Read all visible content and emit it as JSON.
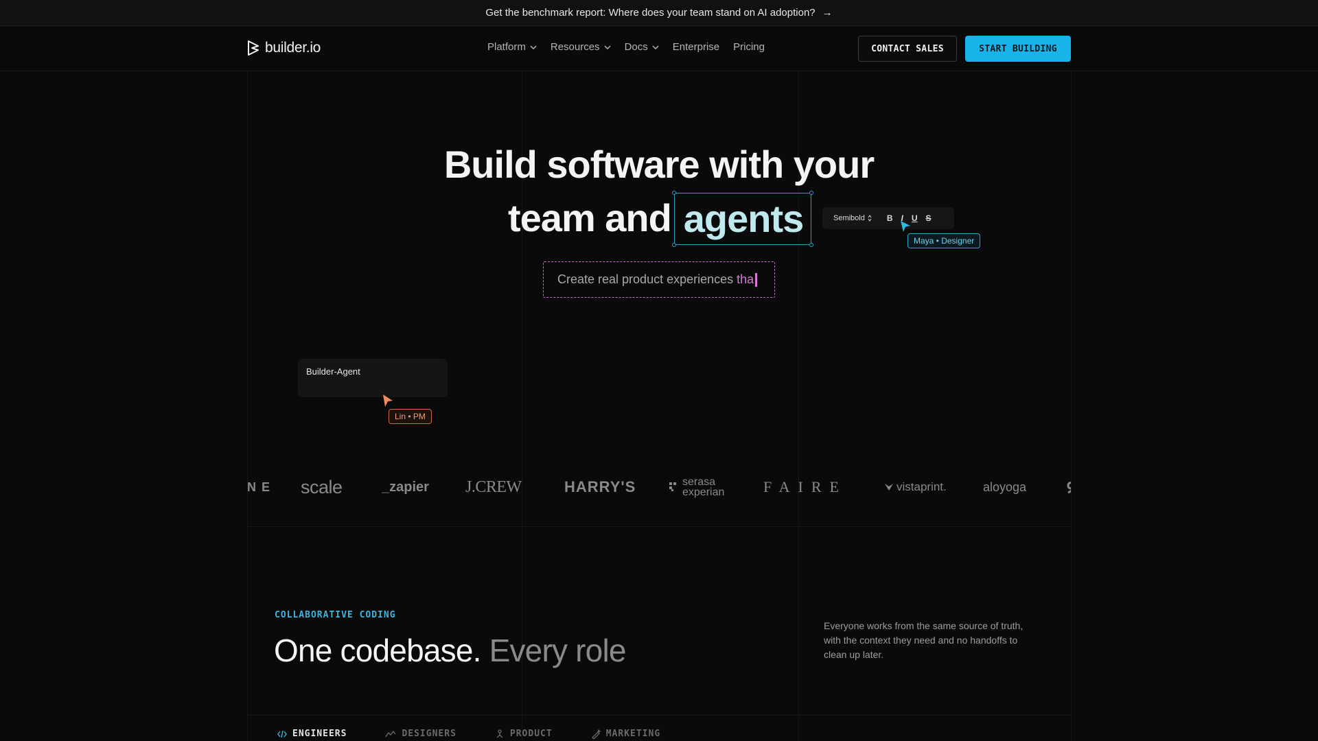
{
  "banner": {
    "text": "Get the benchmark report: Where does your team stand on AI adoption?",
    "arrow": "→"
  },
  "nav": {
    "logo_text": "builder.io",
    "menu": [
      {
        "label": "Platform",
        "has_dropdown": true
      },
      {
        "label": "Resources",
        "has_dropdown": true
      },
      {
        "label": "Docs",
        "has_dropdown": true
      },
      {
        "label": "Enterprise",
        "has_dropdown": false
      },
      {
        "label": "Pricing",
        "has_dropdown": false
      }
    ],
    "contact_label": "CONTACT SALES",
    "start_label": "START BUILDING"
  },
  "hero": {
    "line1": "Build software with your",
    "line2_prefix": "team and",
    "highlight": "agents",
    "subtitle_static": "Create real product experiences",
    "subtitle_typed": "tha",
    "toolbar": {
      "font_weight": "Semibold",
      "bold": "B",
      "italic": "I",
      "underline": "U",
      "strike": "S"
    },
    "designer_tag": "Maya • Designer",
    "agent_card_label": "Builder-Agent",
    "pm_tag": "Lin • PM"
  },
  "logos": [
    "NE",
    "scale",
    "_zapier",
    "J.CREW",
    "HARRY'S",
    "serasa experian",
    "FAIRE",
    "vistaprint.",
    "aloyoga"
  ],
  "section": {
    "eyebrow": "COLLABORATIVE CODING",
    "heading": "One codebase.",
    "heading_muted": "Every role",
    "description": "Everyone works from the same source of truth, with the context they need and no handoffs to clean up later.",
    "tabs": [
      {
        "label": "ENGINEERS",
        "icon": "code-icon"
      },
      {
        "label": "DESIGNERS",
        "icon": "design-icon"
      },
      {
        "label": "PRODUCT",
        "icon": "product-icon"
      },
      {
        "label": "MARKETING",
        "icon": "marketing-icon"
      }
    ]
  },
  "colors": {
    "accent": "#18b4e9",
    "designer": "#2fa6c9",
    "pm": "#c86d45",
    "typing": "#d57ad5"
  }
}
